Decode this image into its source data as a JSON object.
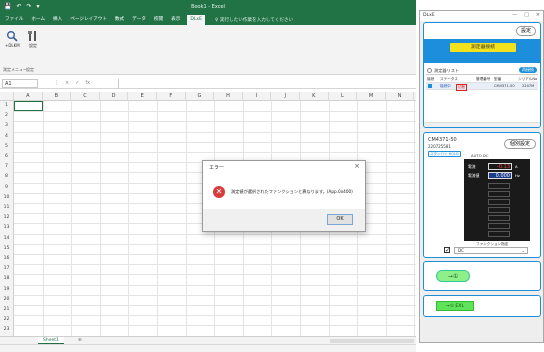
{
  "excel": {
    "title": "Book1 - Excel",
    "qat": [
      "💾",
      "↶",
      "↷",
      "▾"
    ],
    "tabs": [
      "ファイル",
      "ホーム",
      "挿入",
      "ページレイアウト",
      "数式",
      "データ",
      "校閲",
      "表示",
      "DLxE"
    ],
    "active_tab_index": 8,
    "search_placeholder": "♀ 実行したい作業を入力してください",
    "ribbon": {
      "btn1_label": "+DLKM",
      "btn2_label": "設定",
      "group1": "測定メニュー",
      "group2": "設定"
    },
    "namebox": "A1",
    "fx_icons": [
      "⋮",
      "×",
      "✓",
      "fx"
    ],
    "columns": [
      "A",
      "B",
      "C",
      "D",
      "E",
      "F",
      "G",
      "H",
      "I",
      "J",
      "K",
      "L",
      "M",
      "N"
    ],
    "rows": [
      "1",
      "2",
      "3",
      "4",
      "5",
      "6",
      "7",
      "8",
      "9",
      "10",
      "11",
      "12",
      "13",
      "14",
      "15",
      "16",
      "17",
      "18",
      "19",
      "20",
      "21",
      "22",
      "23"
    ],
    "sheet_tab": "Sheet1",
    "add_sheet": "⊕"
  },
  "dialog": {
    "title": "エラー",
    "close": "×",
    "icon": "error-icon",
    "icon_glyph": "✕",
    "message": "測定値が選択されたファンクションと異なります。(App.0x400)",
    "ok_label": "OK"
  },
  "tool": {
    "title": "DLxE",
    "win_controls": [
      "—",
      "□",
      "×"
    ],
    "settei": "設定",
    "measure_btn": "測定器接続",
    "list_label": "測定器リスト",
    "refresh_label": "再接続",
    "table_header": [
      "接続",
      "ステータス",
      "管理番号",
      "型番",
      "シリアルNo"
    ],
    "table_rows": [
      {
        "status": "接続中",
        "tag": "切断",
        "model": "CM4371-50",
        "serial": "2207M"
      }
    ],
    "device_model": "CM4371-50",
    "device_serial": "220725581",
    "device_tag": "スタンバイ\nHOLD",
    "auto_label": "AUTO DC",
    "kobetsu": "個別設定",
    "readout": [
      {
        "label": "電流",
        "value": "-0.13",
        "unit": "A"
      },
      {
        "label": "電流値",
        "value": "0.000",
        "unit": "Hz"
      }
    ],
    "func_label": "ファンクション指定",
    "func_checked": "✓",
    "func_value": "DC",
    "func_arrow": "⌄",
    "green_btn": "→①",
    "excel_btn": "→① EXL"
  },
  "colors": {
    "excel_green": "#217346",
    "tool_blue": "#1c8edb",
    "yellow": "#f2e21e",
    "green": "#8ff08a",
    "error_red": "#d83b3b"
  }
}
